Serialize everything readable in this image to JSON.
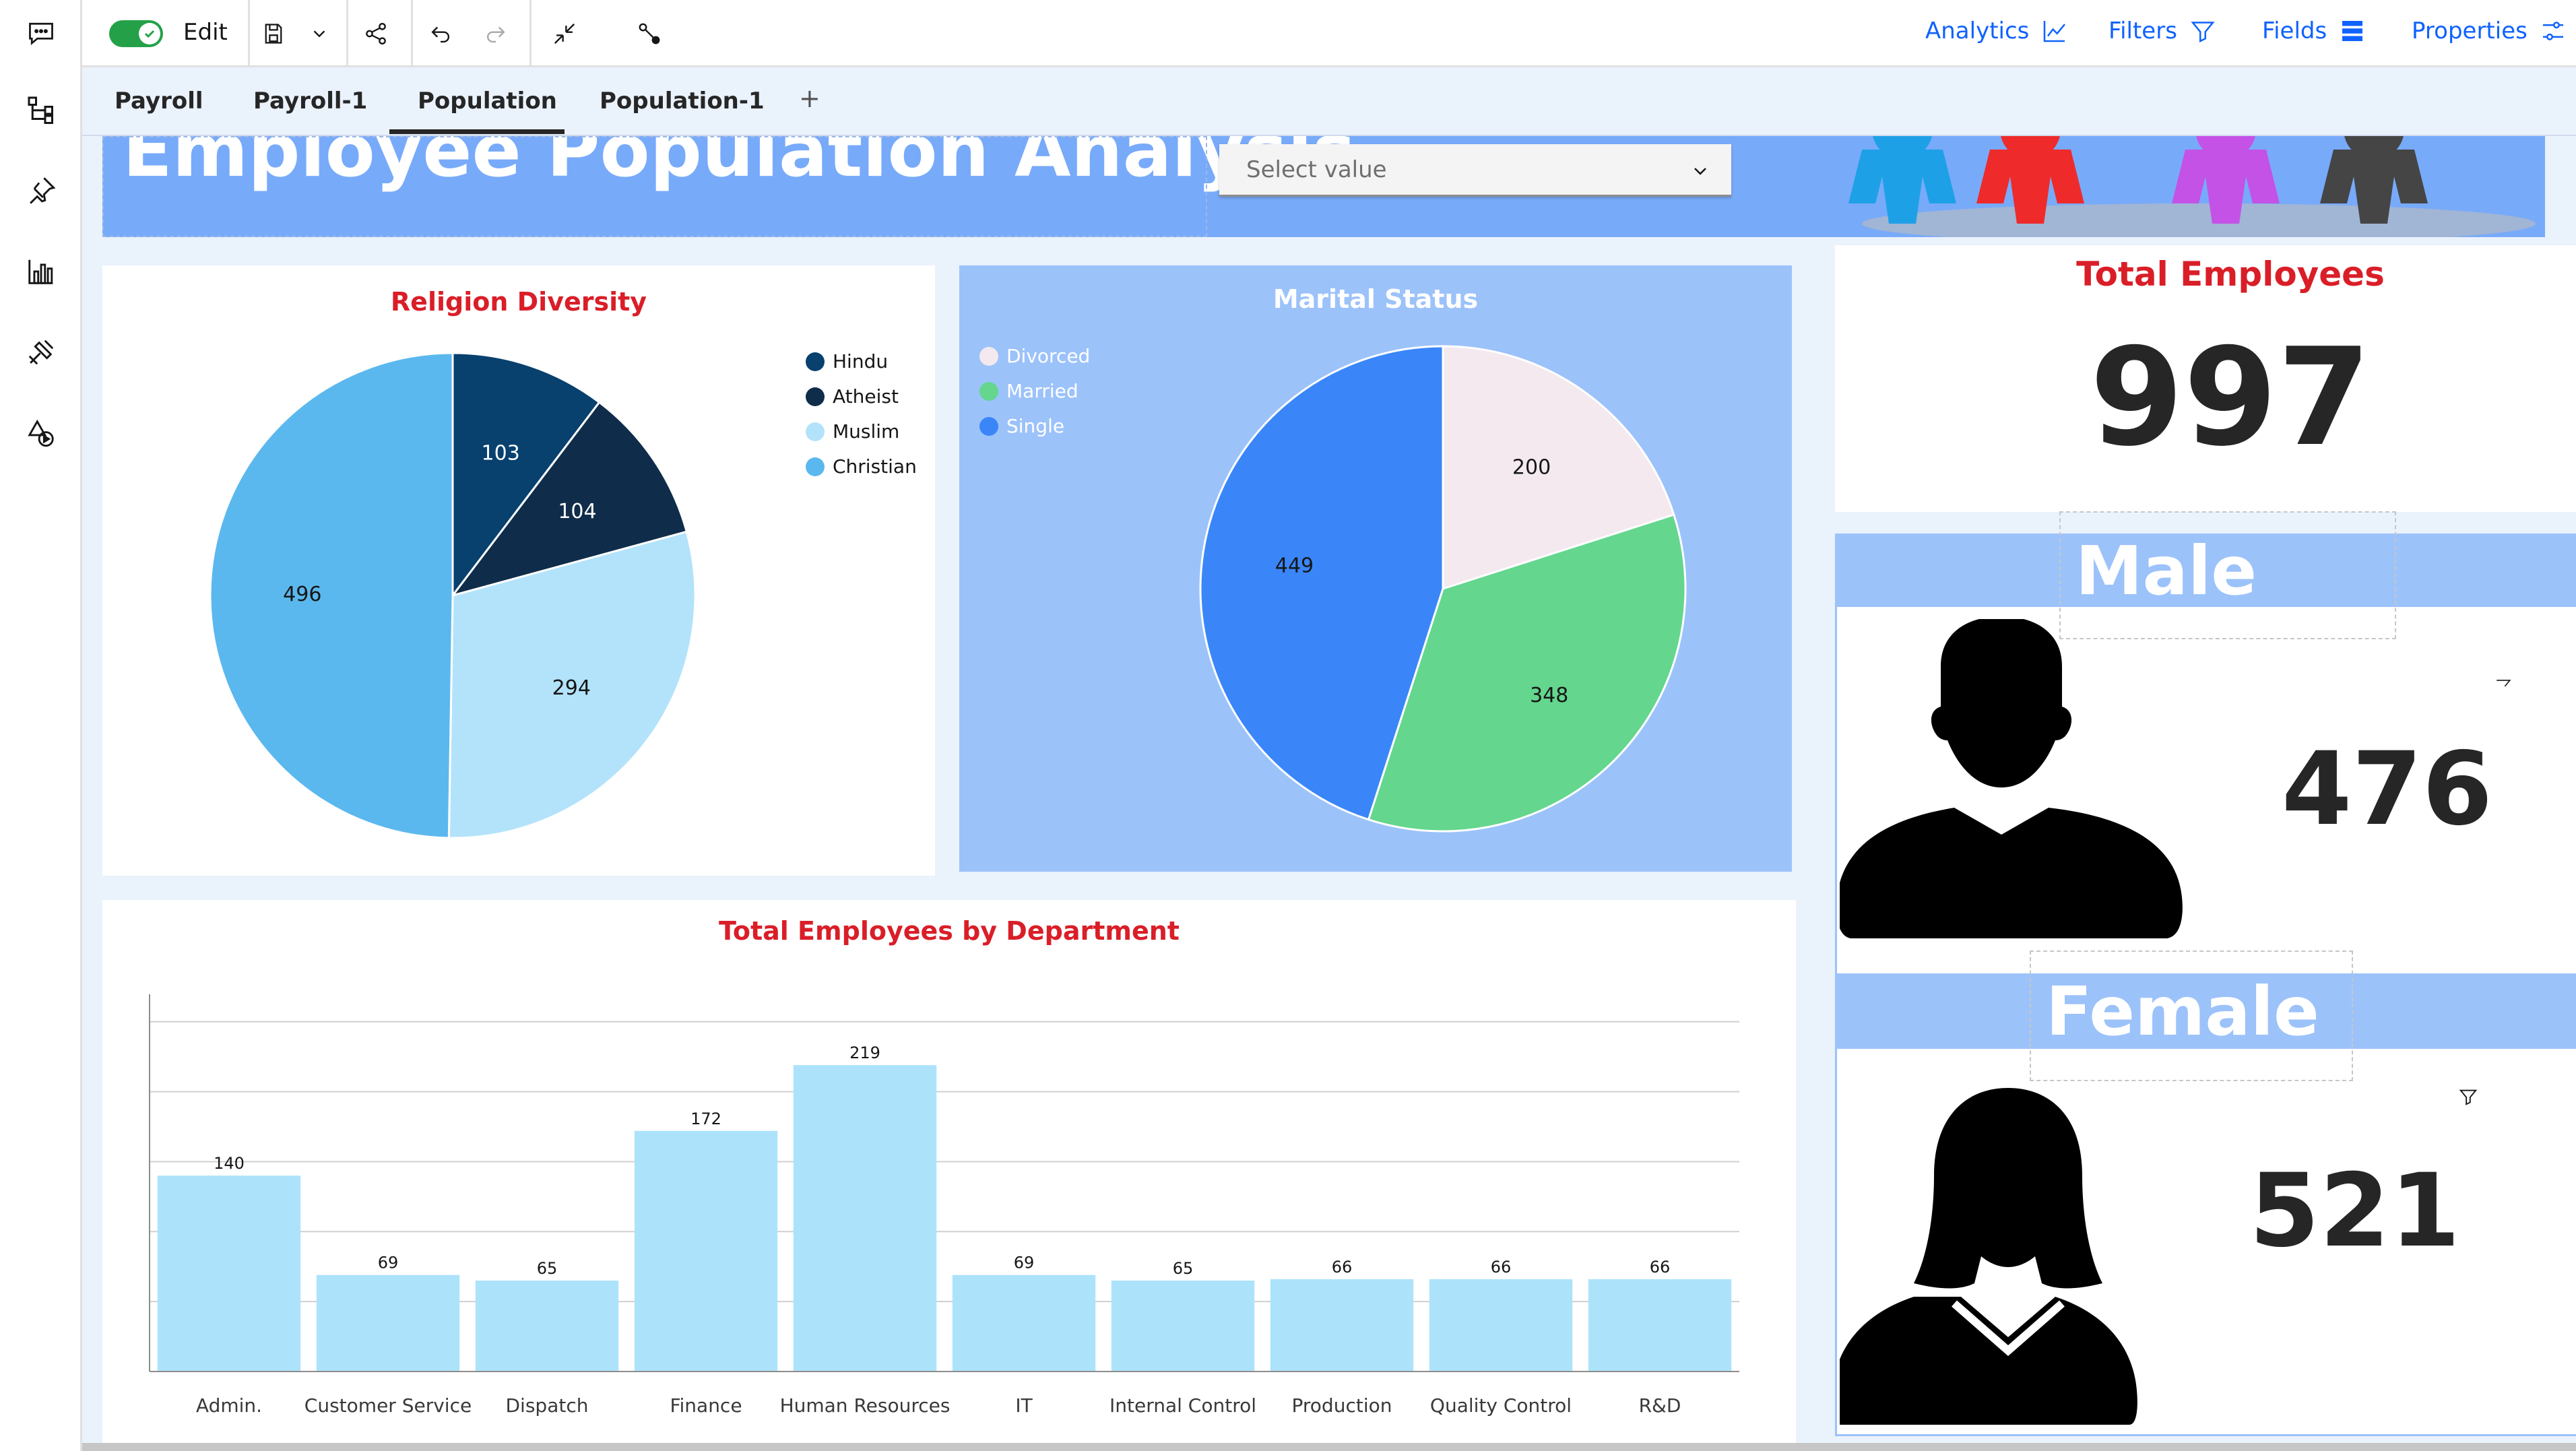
{
  "toolbar": {
    "edit_label": "Edit",
    "actions": [
      {
        "label": "Analytics",
        "icon": "analytics-icon"
      },
      {
        "label": "Filters",
        "icon": "filter-icon"
      },
      {
        "label": "Fields",
        "icon": "fields-icon"
      },
      {
        "label": "Properties",
        "icon": "properties-icon"
      }
    ]
  },
  "tabs": [
    {
      "label": "Payroll"
    },
    {
      "label": "Payroll-1"
    },
    {
      "label": "Population",
      "active": true
    },
    {
      "label": "Population-1"
    }
  ],
  "tab_add": "+",
  "header": {
    "title": "Employee Population Analysis",
    "select_placeholder": "Select value"
  },
  "religion": {
    "title": "Religion Diversity",
    "legend": [
      "Hindu",
      "Atheist",
      "Muslim",
      "Christian"
    ]
  },
  "marital": {
    "title": "Marital Status",
    "legend": [
      "Divorced",
      "Married",
      "Single"
    ]
  },
  "kpi": {
    "total_title": "Total Employees",
    "total_value": "997",
    "male_label": "Male",
    "male_value": "476",
    "female_label": "Female",
    "female_value": "521"
  },
  "colors": {
    "accent": "#0f62fe",
    "title_red": "#da1e28",
    "hindu": "#08406e",
    "atheist": "#0f2d4a",
    "muslim": "#b3e3fa",
    "christian": "#5bb8ee",
    "divorced": "#f3e9ef",
    "married": "#64d68e",
    "single": "#3a86f8",
    "bar": "#ace3fb"
  },
  "chart_data": [
    {
      "type": "pie",
      "title": "Religion Diversity",
      "categories": [
        "Hindu",
        "Atheist",
        "Muslim",
        "Christian"
      ],
      "values": [
        103,
        104,
        294,
        496
      ],
      "legend": "top-right"
    },
    {
      "type": "pie",
      "title": "Marital Status",
      "categories": [
        "Divorced",
        "Married",
        "Single"
      ],
      "values": [
        200,
        348,
        449
      ],
      "legend": "top-left"
    },
    {
      "type": "bar",
      "title": "Total Employees by Department",
      "categories": [
        "Admin.",
        "Customer Service",
        "Dispatch",
        "Finance",
        "Human Resources",
        "IT",
        "Internal Control",
        "Production",
        "Quality Control",
        "R&D"
      ],
      "values": [
        140,
        69,
        65,
        172,
        219,
        69,
        65,
        66,
        66,
        66
      ],
      "ylim": [
        0,
        260
      ],
      "grid": true
    }
  ]
}
